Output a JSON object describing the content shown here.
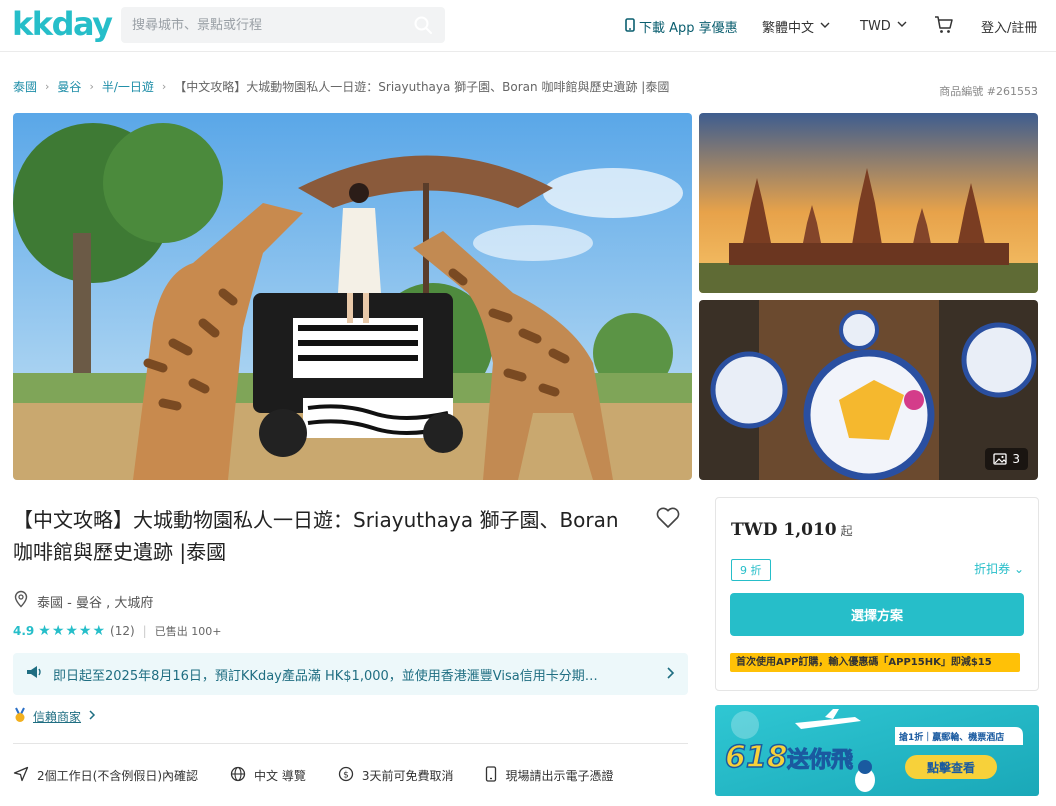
{
  "header": {
    "logo": "kkday",
    "search_placeholder": "搜尋城市、景點或行程",
    "app_download": "下載 App 享優惠",
    "language": "繁體中文",
    "currency": "TWD",
    "login": "登入/註冊"
  },
  "breadcrumb": {
    "items": [
      "泰國",
      "曼谷",
      "半/一日遊"
    ],
    "current": "【中文攻略】大城動物園私人一日遊：Sriayuthaya 獅子園、Boran 咖啡館與歷史遺跡 |泰國",
    "product_no": "商品編號 #261553"
  },
  "gallery": {
    "photo_count": "3"
  },
  "product": {
    "title": "【中文攻略】大城動物園私人一日遊：Sriayuthaya 獅子園、Boran 咖啡館與歷史遺跡 |泰國",
    "location": "泰國 - 曼谷 , 大城府",
    "rating": "4.9",
    "stars": "★★★★★",
    "review_count": "(12)",
    "sold": "已售出 100+",
    "promo_text": "即日起至2025年8月16日，預訂KKday產品滿 HK$1,000，並使用香港滙豐Visa信用卡分期…",
    "trusted_merchant": "信賴商家",
    "features": [
      {
        "icon": "send-icon",
        "label": "2個工作日(不含例假日)內確認"
      },
      {
        "icon": "globe-icon",
        "label": "中文 導覽"
      },
      {
        "icon": "refund-icon",
        "label": "3天前可免費取消"
      },
      {
        "icon": "phone-icon",
        "label": "現場請出示電子憑證"
      }
    ]
  },
  "price_card": {
    "price": "TWD 1,010",
    "from": "起",
    "discount": "9 折",
    "coupon": "折扣券",
    "select_button": "選擇方案",
    "app_promo": "首次使用APP訂購，輸入優惠碼「APP15HK」即減$15"
  },
  "banner": {
    "number": "618",
    "headline": "送你飛",
    "sub": "搶1折｜贏郵輪、機票酒店",
    "cta": "點擊查看"
  },
  "colors": {
    "brand": "#26bec9",
    "link": "#1f8ea8",
    "promo_bg": "#edf8fa",
    "app_promo_bg": "#ffc107"
  }
}
